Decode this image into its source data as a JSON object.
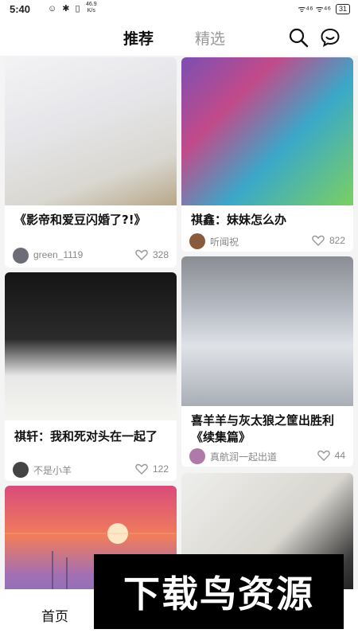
{
  "status_bar": {
    "time": "5:40",
    "left_icons": "☺ ✱ ▯",
    "net_speed_value": "46.9",
    "net_speed_unit": "K/s",
    "signal": "ᯤ⁴⁶ ᯤ⁴⁶",
    "battery": "31"
  },
  "header": {
    "tab_recommend": "推荐",
    "tab_featured": "精选",
    "search_icon": "search-icon",
    "chat_icon": "chat-bubble-icon"
  },
  "feed": {
    "cards": [
      {
        "title": "《影帝和爱豆闪婚了?!》",
        "author": "green_1119",
        "likes": "328",
        "avatar_color": "#6d6d78"
      },
      {
        "title": "祺鑫：妹妹怎么办",
        "author": "听闻祝",
        "likes": "822",
        "avatar_color": "#8a5a3c"
      },
      {
        "title": "祺轩：我和死对头在一起了",
        "author": "不是小羊",
        "likes": "122",
        "avatar_color": "#444444"
      },
      {
        "title": "喜羊羊与灰太狼之筐出胜利《续集篇》",
        "author": "真航润一起出道",
        "likes": "44",
        "avatar_color": "#b07aa8"
      },
      {
        "title": "",
        "author": "",
        "likes": ""
      },
      {
        "title": "",
        "author": "",
        "likes": ""
      }
    ]
  },
  "bottom_nav": {
    "home": "首页"
  },
  "watermark": {
    "text": "下载鸟资源"
  },
  "colors": {
    "active_tab": "#111111",
    "inactive_tab": "#999999",
    "background": "#f4f4f4"
  }
}
